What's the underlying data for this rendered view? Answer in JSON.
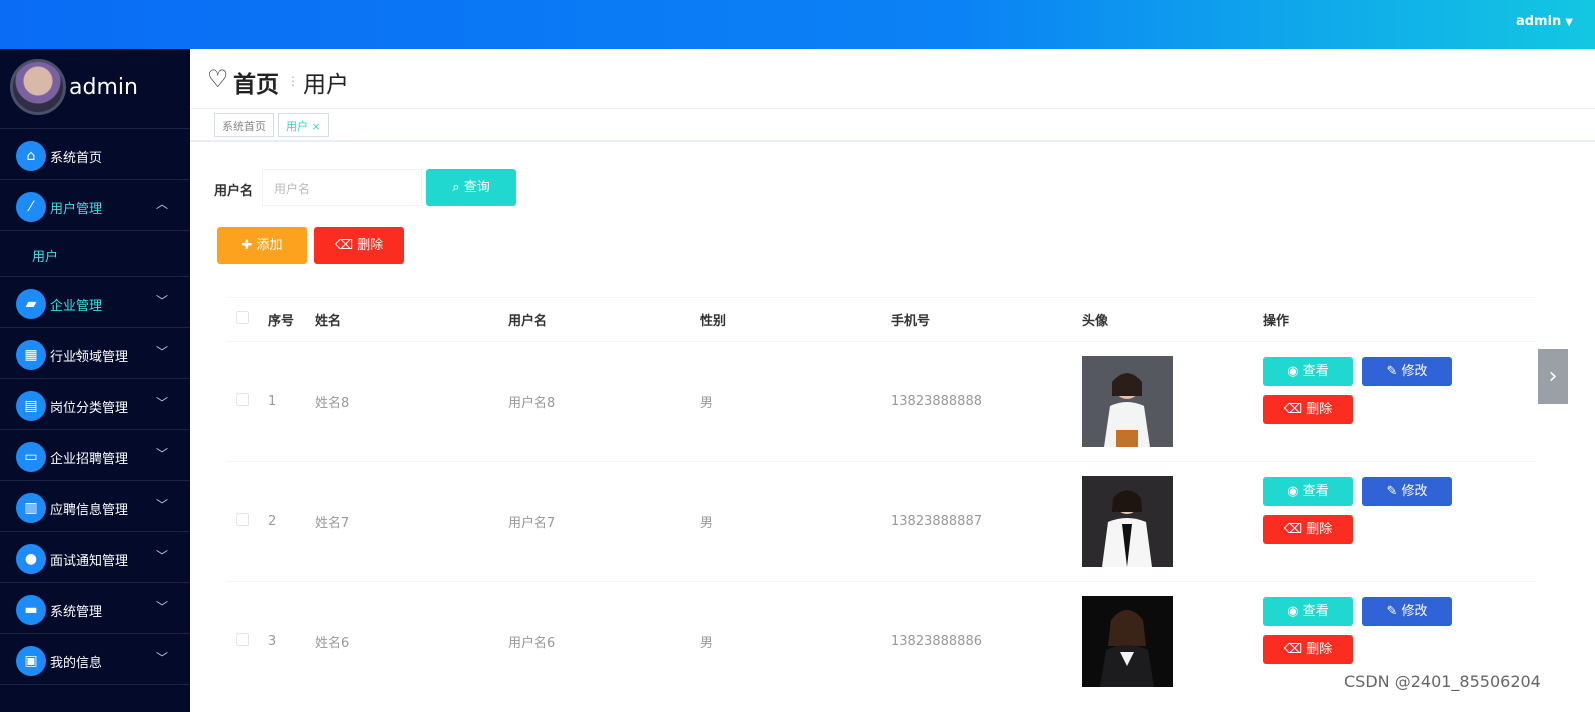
{
  "topbar": {
    "user": "admin"
  },
  "sidebar": {
    "profile_name": "admin",
    "items": [
      {
        "label": "系统首页",
        "icon": "home-icon"
      },
      {
        "label": "用户管理",
        "icon": "chart-icon",
        "expanded": true
      },
      {
        "label": "企业管理",
        "icon": "briefcase-icon"
      },
      {
        "label": "行业领域管理",
        "icon": "grid-icon"
      },
      {
        "label": "岗位分类管理",
        "icon": "clipboard-icon"
      },
      {
        "label": "企业招聘管理",
        "icon": "monitor-icon"
      },
      {
        "label": "应聘信息管理",
        "icon": "book-icon"
      },
      {
        "label": "面试通知管理",
        "icon": "person-icon"
      },
      {
        "label": "系统管理",
        "icon": "chat-icon"
      },
      {
        "label": "我的信息",
        "icon": "card-icon"
      }
    ],
    "subitem": "用户"
  },
  "header": {
    "title_main": "首页",
    "title_sub": "用户"
  },
  "tabs": [
    {
      "label": "系统首页"
    },
    {
      "label": "用户 ×"
    }
  ],
  "search": {
    "label": "用户名",
    "placeholder": "用户名",
    "button": "查询"
  },
  "actions": {
    "add": "添加",
    "delete": "删除"
  },
  "table": {
    "columns": [
      "序号",
      "姓名",
      "用户名",
      "性别",
      "手机号",
      "头像",
      "操作"
    ],
    "rows": [
      {
        "index": "1",
        "name": "姓名8",
        "username": "用户名8",
        "gender": "男",
        "phone": "13823888888"
      },
      {
        "index": "2",
        "name": "姓名7",
        "username": "用户名7",
        "gender": "男",
        "phone": "13823888887"
      },
      {
        "index": "3",
        "name": "姓名6",
        "username": "用户名6",
        "gender": "男",
        "phone": "13823888886"
      }
    ],
    "row_actions": {
      "view": "查看",
      "edit": "修改",
      "remove": "删除"
    }
  },
  "watermark": "CSDN @2401_85506204",
  "colors": {
    "accent": "#21d8d0",
    "danger": "#fb2d21",
    "warning": "#fca21f",
    "primary": "#2f63d6",
    "sidebar": "#030a2a"
  }
}
